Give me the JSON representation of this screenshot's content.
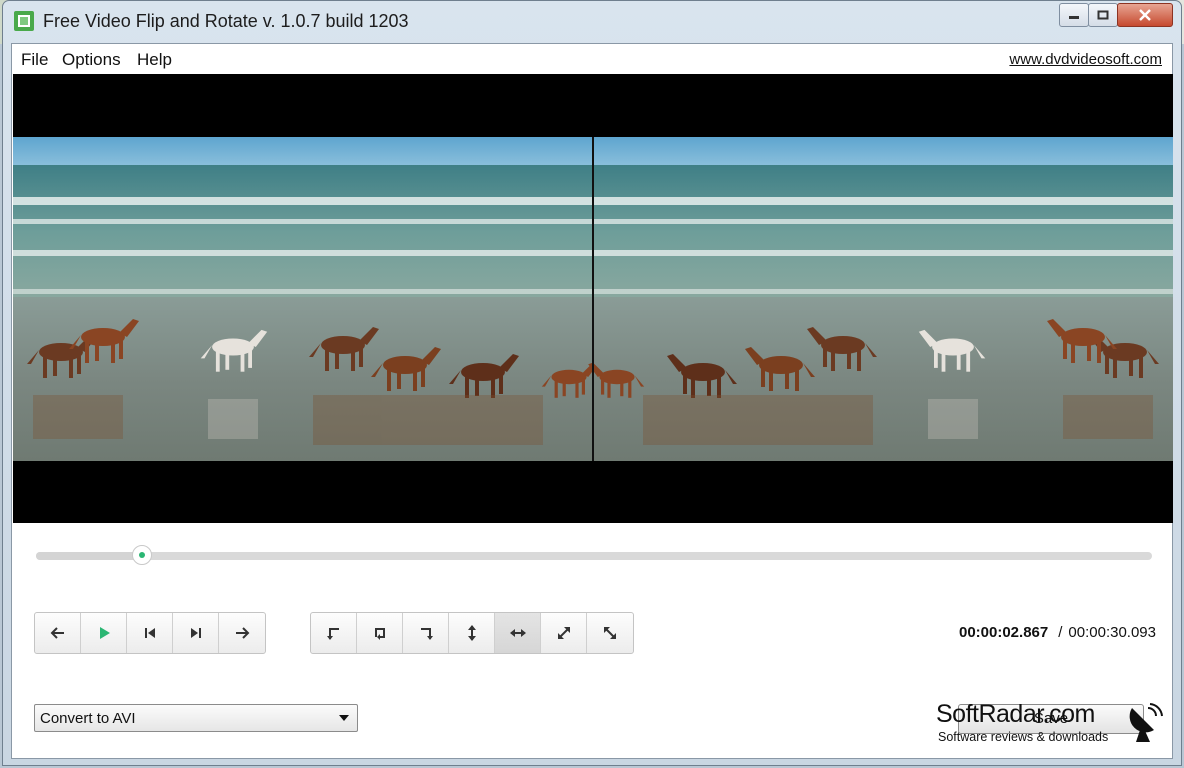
{
  "window": {
    "title": "Free Video Flip and Rotate v. 1.0.7 build 1203",
    "controls": [
      "minimize-icon",
      "maximize-icon",
      "close-icon"
    ]
  },
  "menu": {
    "items": [
      "File",
      "Options",
      "Help"
    ],
    "site_link": "www.dvdvideosoft.com"
  },
  "seek": {
    "position_fraction": 0.095
  },
  "playback_controls": [
    {
      "name": "prev-frame-button",
      "icon": "arrow-left-icon"
    },
    {
      "name": "play-button",
      "icon": "play-icon"
    },
    {
      "name": "go-start-button",
      "icon": "skip-start-icon"
    },
    {
      "name": "go-end-button",
      "icon": "skip-end-icon"
    },
    {
      "name": "next-frame-button",
      "icon": "arrow-right-icon"
    }
  ],
  "transform_controls": [
    {
      "name": "rotate-ccw-button",
      "icon": "rotate-left-icon"
    },
    {
      "name": "rotate-180-button",
      "icon": "rotate-180-icon"
    },
    {
      "name": "rotate-cw-button",
      "icon": "rotate-right-icon"
    },
    {
      "name": "flip-vertical-button",
      "icon": "flip-vertical-icon"
    },
    {
      "name": "flip-horizontal-button",
      "icon": "flip-horizontal-icon",
      "pressed": true
    },
    {
      "name": "transpose-button",
      "icon": "diagonal-icon"
    },
    {
      "name": "transverse-button",
      "icon": "diagonal-alt-icon"
    }
  ],
  "time": {
    "current": "00:00:02.867",
    "separator": "/",
    "total": "00:00:30.093"
  },
  "output_format": {
    "selected": "Convert to AVI"
  },
  "save_button": {
    "label": "Save"
  },
  "watermark": {
    "brand": "SoftRadar.com",
    "tagline": "Software reviews & downloads"
  },
  "colors": {
    "accent_green": "#2bb673",
    "video_bg": "#000000"
  }
}
